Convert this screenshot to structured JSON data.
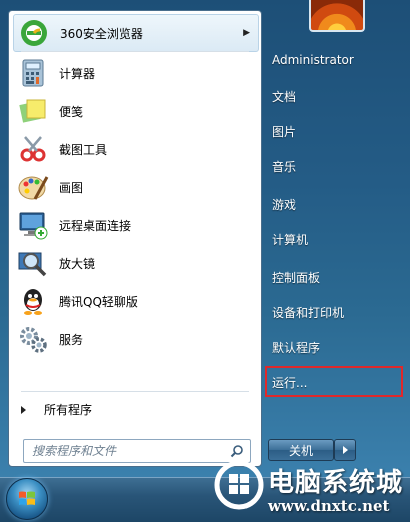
{
  "programs": [
    {
      "label": "360安全浏览器",
      "icon": "browser-360-icon",
      "has_submenu": true
    },
    {
      "label": "计算器",
      "icon": "calculator-icon"
    },
    {
      "label": "便笺",
      "icon": "sticky-notes-icon"
    },
    {
      "label": "截图工具",
      "icon": "snipping-tool-icon"
    },
    {
      "label": "画图",
      "icon": "paint-icon"
    },
    {
      "label": "远程桌面连接",
      "icon": "remote-desktop-icon"
    },
    {
      "label": "放大镜",
      "icon": "magnifier-icon"
    },
    {
      "label": "腾讯QQ轻聊版",
      "icon": "qq-icon"
    },
    {
      "label": "服务",
      "icon": "services-icon"
    }
  ],
  "all_programs_label": "所有程序",
  "search": {
    "placeholder": "搜索程序和文件"
  },
  "right_panel": {
    "username": "Administrator",
    "items": [
      "文档",
      "图片",
      "音乐",
      "游戏",
      "计算机",
      "控制面板",
      "设备和打印机",
      "默认程序",
      "运行..."
    ]
  },
  "shutdown_label": "关机",
  "watermark": {
    "title": "电脑系统城",
    "url": "www.dnxtc.net"
  },
  "colors": {
    "highlight_border": "#e0282a",
    "desktop_blue": "#245c86"
  }
}
